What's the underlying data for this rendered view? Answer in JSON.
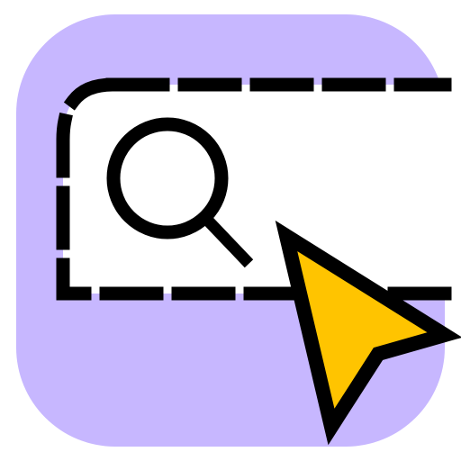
{
  "app_icon": {
    "name": "search-selection-cursor",
    "colors": {
      "background": "#c7b7ff",
      "panel": "#ffffff",
      "outline": "#000000",
      "cursor_fill": "#ffc400"
    },
    "icons": {
      "tile": "rounded-tile",
      "selection": "dashed-selection-box",
      "search": "magnifier-icon",
      "pointer": "cursor-arrow-icon"
    }
  }
}
